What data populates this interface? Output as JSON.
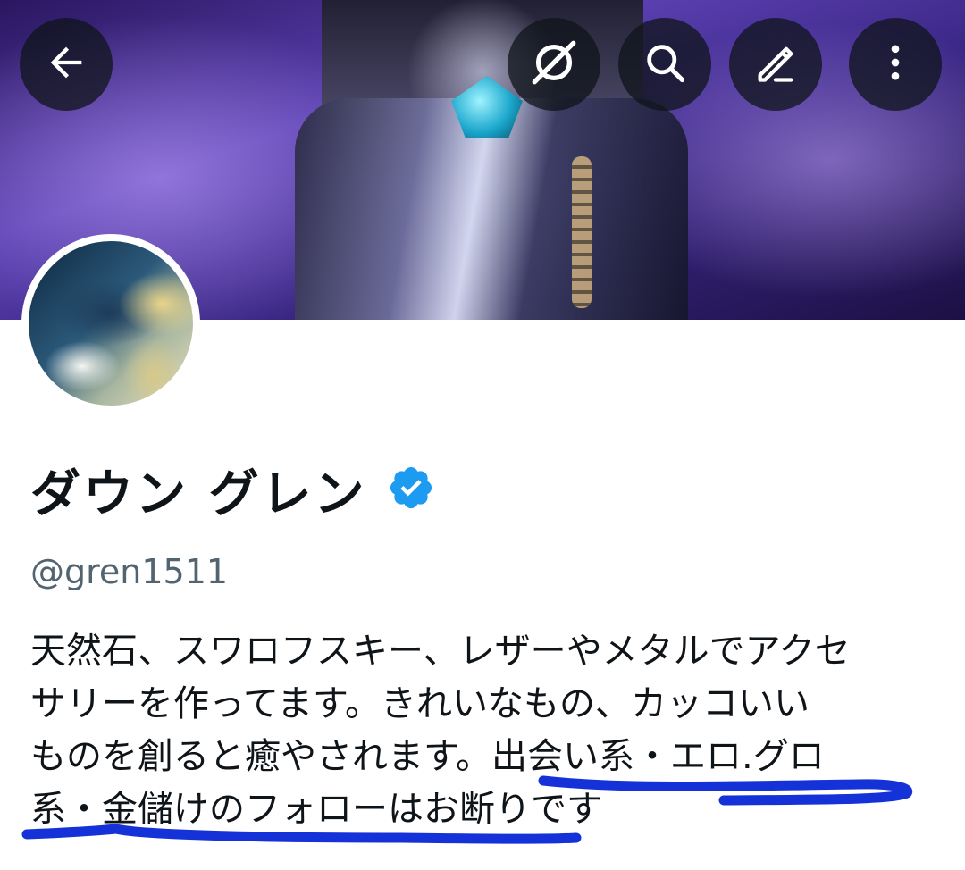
{
  "header": {
    "back_icon": "arrow-left-icon",
    "actions": [
      "grok-icon",
      "search-icon",
      "edit-icon",
      "more-vertical-icon"
    ]
  },
  "profile": {
    "name": "ダウン グレン",
    "verified_badge": "verified-badge-icon",
    "handle": "@gren1511",
    "bio_lines": [
      "天然石、スワロフスキー、レザーやメタルでアクセ",
      "サリーを作ってます。きれいなもの、カッコいい",
      "ものを創ると癒やされます。出会い系・エロ.グロ",
      "系・金儲けのフォローはお断りです"
    ]
  },
  "colors": {
    "text_primary": "#0f1419",
    "text_secondary": "#536471",
    "verified_blue": "#1d9bf0",
    "annotation_blue": "#1432d8"
  }
}
